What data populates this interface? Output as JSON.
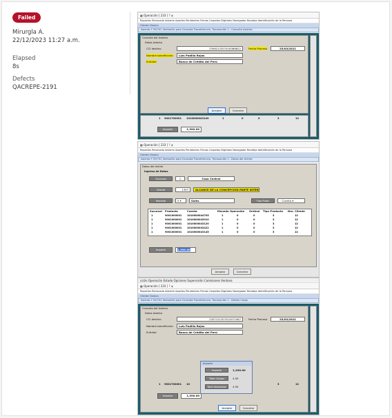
{
  "result": {
    "status": "Failed",
    "user": "Mirurgla A.",
    "datetime": "22/12/2023 11:27 a.m.",
    "elapsed_label": "Elapsed",
    "elapsed_value": "8s",
    "defects_label": "Defects",
    "defect_id": "QACREPE-2191"
  },
  "common": {
    "toolbar_text": "Operación  [ 233 ]",
    "menu": "Reportes   Renovado Adverts   Aportes Pendientes   Firmas   Carpetas Digitales   Navegador   Bandeja   Identificación de la Persona",
    "breadcrumb_top": "Cliente Clasico",
    "accept": "Aceptar",
    "cancel": "Cancelar"
  },
  "shot1": {
    "window_title": "Asiento Y 09/741 Ventanilla para Consulta Transferencia, Transacción 1 - Consulta Asiento",
    "group": "Consulta del Asiento",
    "subgroup": "Datos Asiento",
    "cci_label": "CCI destino",
    "cci_value": "2306212307418368622",
    "date_label": "Fecha Proceso",
    "date_value": "25/03/2021",
    "beneficiary_label": "Nombre beneficiario",
    "beneficiary_value": "Luis Padilla Rojas",
    "bank_label": "Entidad",
    "bank_value": "Banco de Crédito del Perú",
    "grid_row": [
      "1",
      "9001700001",
      "1010000043149",
      "1",
      "0",
      "0",
      "3",
      "12"
    ],
    "amount_label": "Importe",
    "amount_value": "1,390.00"
  },
  "shot2": {
    "window_title": "Asiento Y 09/741 Ventanilla para Consulta Transferencia, Transacción 1 - Datos del cliente",
    "group": "Datos del cliente",
    "subgroup": "Ingreso de Datos",
    "branch_label": "Sucursal",
    "branch_code": "1",
    "branch_name": "Caso Central",
    "client_label": "Cliente",
    "client_code": "1397",
    "client_name": "ALCANCE DE LA CONCEPCION PARTE INTEREA",
    "currency_label": "Moneda",
    "currency_code": "0",
    "currency_name": "Soles",
    "type_label": "Tipo Prodc",
    "type_value": "Cuenta",
    "table_headers": [
      "Sucursal",
      "Producto",
      "Cuenta",
      "Moneda",
      "Operación",
      "Ordinal",
      "Tipo Producto",
      "Nro. Cliente"
    ],
    "table_rows": [
      [
        "1",
        "9001000001",
        "1010000044705",
        "1",
        "0",
        "0",
        "3",
        "12"
      ],
      [
        "1",
        "9001000001",
        "1010000043910",
        "1",
        "0",
        "0",
        "3",
        "12"
      ],
      [
        "1",
        "9001000001",
        "1010000043120",
        "1",
        "0",
        "0",
        "3",
        "12"
      ],
      [
        "1",
        "9001000001",
        "1010000043422",
        "1",
        "0",
        "0",
        "3",
        "12"
      ],
      [
        "1",
        "9001000001",
        "1010000043145",
        "1",
        "0",
        "0",
        "3",
        "12"
      ]
    ],
    "amount_label": "Importe",
    "amount_value": "1,390.00"
  },
  "shot3": {
    "top_menu": "cción  Operación  Estado  Opciones  Supervisión  Comisiones  Ventana",
    "window_title": "Asiento Y 09/741 Ventanilla para Consulta Transferencia, Transacción 1 - Debito Cargo",
    "group": "Consulta del Asiento",
    "subgroup": "Datos Asiento",
    "cci_label": "CCI destino",
    "cci_value": "2307121307410071067",
    "date_label": "Fecha Proceso",
    "date_value": "25/03/2021",
    "beneficiary_label": "Nombre beneficiario",
    "beneficiary_value": "Luis Padilla Rojas",
    "bank_label": "Entidad",
    "bank_value": "Banco de Crédito del Perú",
    "grid_row": [
      "1",
      "9001700001",
      "10",
      "3",
      "12"
    ],
    "amount_label": "Importe",
    "amount_value": "1,390.00",
    "popup_title": "Importe",
    "popup_rows": [
      {
        "label": "Importe",
        "value": "1,290.00"
      },
      {
        "label": "Total Cargos",
        "value": "4.50"
      },
      {
        "label": "Total Abonados",
        "value": "4.50"
      }
    ]
  }
}
